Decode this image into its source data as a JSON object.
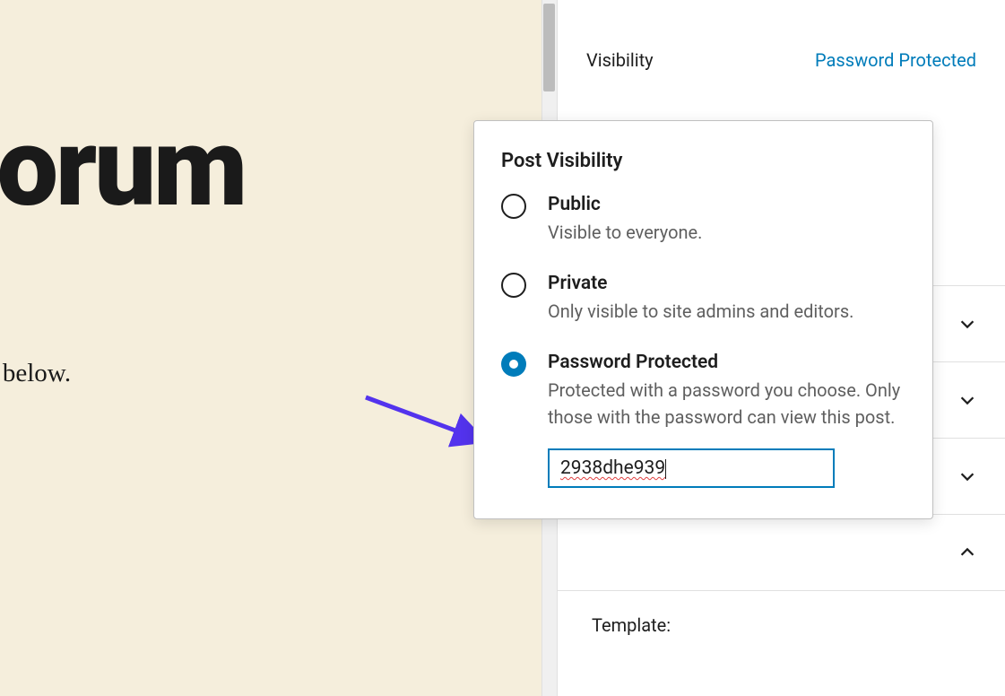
{
  "editor": {
    "title_fragment": "nly Forum",
    "subtitle_fragment": "in the field below."
  },
  "sidebar": {
    "visibility": {
      "label": "Visibility",
      "value": "Password Protected"
    },
    "template_label": "Template:"
  },
  "popover": {
    "title": "Post Visibility",
    "options": {
      "public": {
        "label": "Public",
        "desc": "Visible to everyone."
      },
      "private": {
        "label": "Private",
        "desc": "Only visible to site admins and editors."
      },
      "password_protected": {
        "label": "Password Protected",
        "desc": "Protected with a password you choose. Only those with the password can view this post."
      }
    },
    "password_value": "2938dhe939"
  }
}
